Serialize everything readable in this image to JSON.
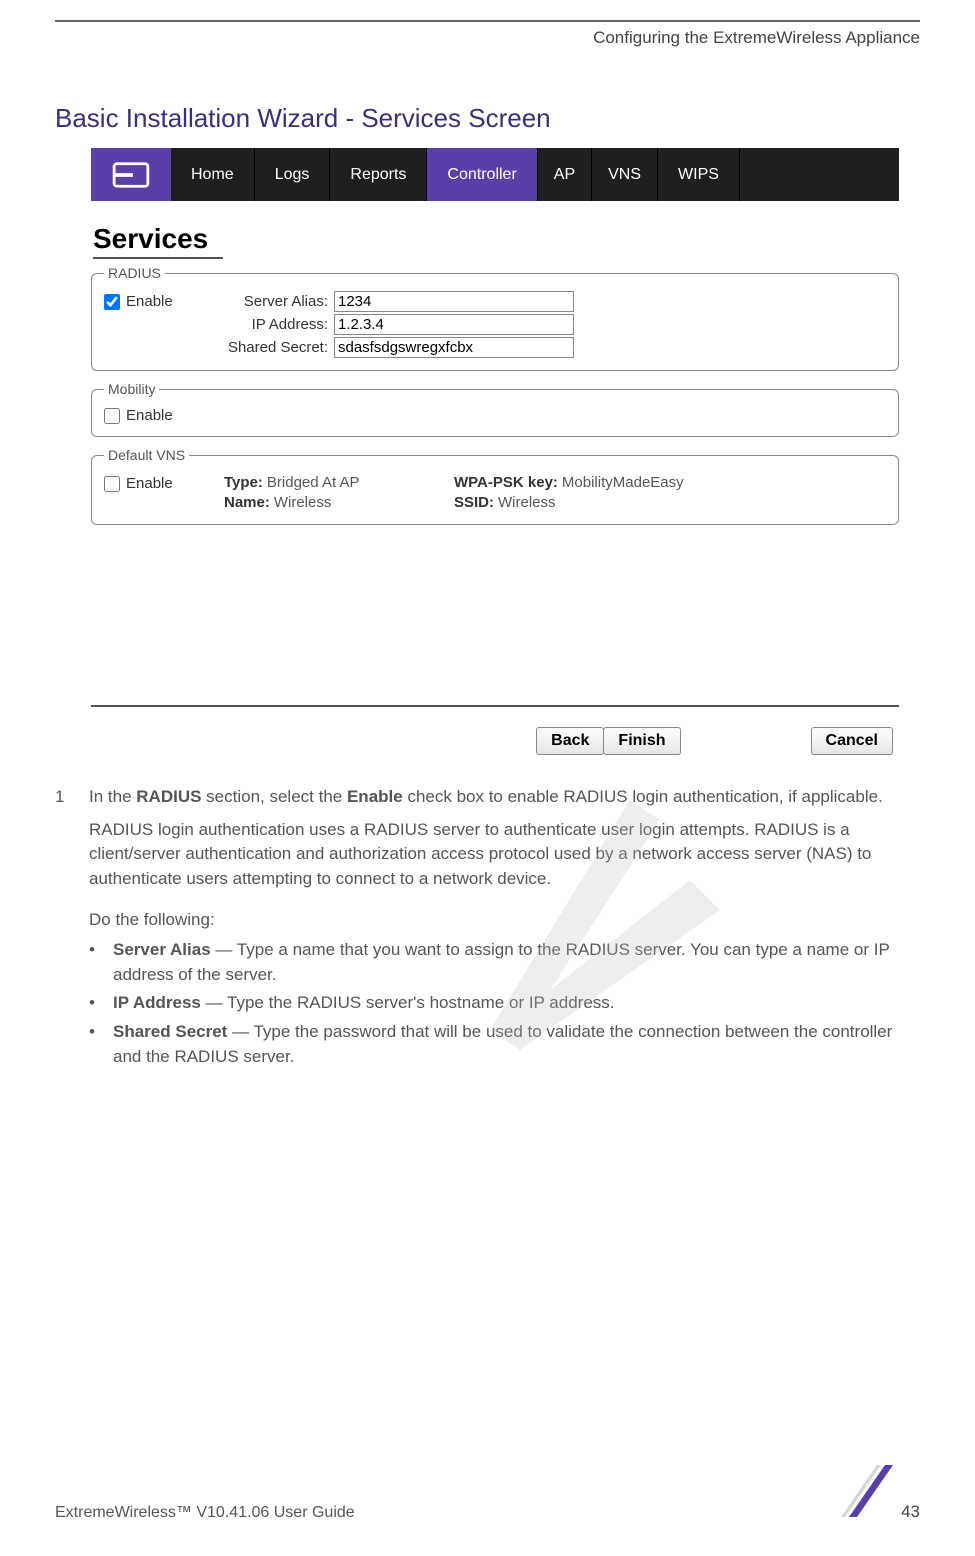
{
  "header": {
    "chapter": "Configuring the ExtremeWireless Appliance"
  },
  "section_title": "Basic Installation Wizard - Services Screen",
  "tabs": {
    "home": "Home",
    "logs": "Logs",
    "reports": "Reports",
    "controller": "Controller",
    "ap": "AP",
    "vns": "VNS",
    "wips": "WIPS"
  },
  "screenshot": {
    "services_heading": "Services",
    "radius": {
      "legend": "RADIUS",
      "enable_label": "Enable",
      "enable_checked": true,
      "server_alias_label": "Server Alias:",
      "server_alias_value": "1234",
      "ip_address_label": "IP Address:",
      "ip_address_value": "1.2.3.4",
      "shared_secret_label": "Shared Secret:",
      "shared_secret_value": "sdasfsdgswregxfcbx"
    },
    "mobility": {
      "legend": "Mobility",
      "enable_label": "Enable",
      "enable_checked": false
    },
    "default_vns": {
      "legend": "Default VNS",
      "enable_label": "Enable",
      "enable_checked": false,
      "type_label": "Type:",
      "type_value": "Bridged At AP",
      "wpa_label": "WPA-PSK key:",
      "wpa_value": "MobilityMadeEasy",
      "name_label": "Name:",
      "name_value": "Wireless",
      "ssid_label": "SSID:",
      "ssid_value": "Wireless"
    },
    "buttons": {
      "back": "Back",
      "finish": "Finish",
      "cancel": "Cancel"
    }
  },
  "steps": {
    "num1": "1",
    "step1_text_a": "In the ",
    "step1_text_b": "RADIUS",
    "step1_text_c": " section, select the ",
    "step1_text_d": "Enable",
    "step1_text_e": " check box to enable RADIUS login authentication, if applicable.",
    "step1_para": "RADIUS login authentication uses a RADIUS server to authenticate user login attempts. RADIUS is a client/server authentication and authorization access protocol used by a network access server (NAS) to authenticate users attempting to connect to a network device.",
    "do_following": "Do the following:",
    "bullets": {
      "server_alias_bold": "Server Alias",
      "server_alias_rest": " — Type a name that you want to assign to the RADIUS server. You can type a name or IP address of the server.",
      "ip_address_bold": "IP Address",
      "ip_address_rest": " — Type the RADIUS server's hostname or IP address.",
      "shared_secret_bold": "Shared Secret",
      "shared_secret_rest": " — Type the password that will be used to validate the connection between the controller and the RADIUS server."
    }
  },
  "footer": {
    "guide": "ExtremeWireless™ V10.41.06 User Guide",
    "page": "43"
  }
}
